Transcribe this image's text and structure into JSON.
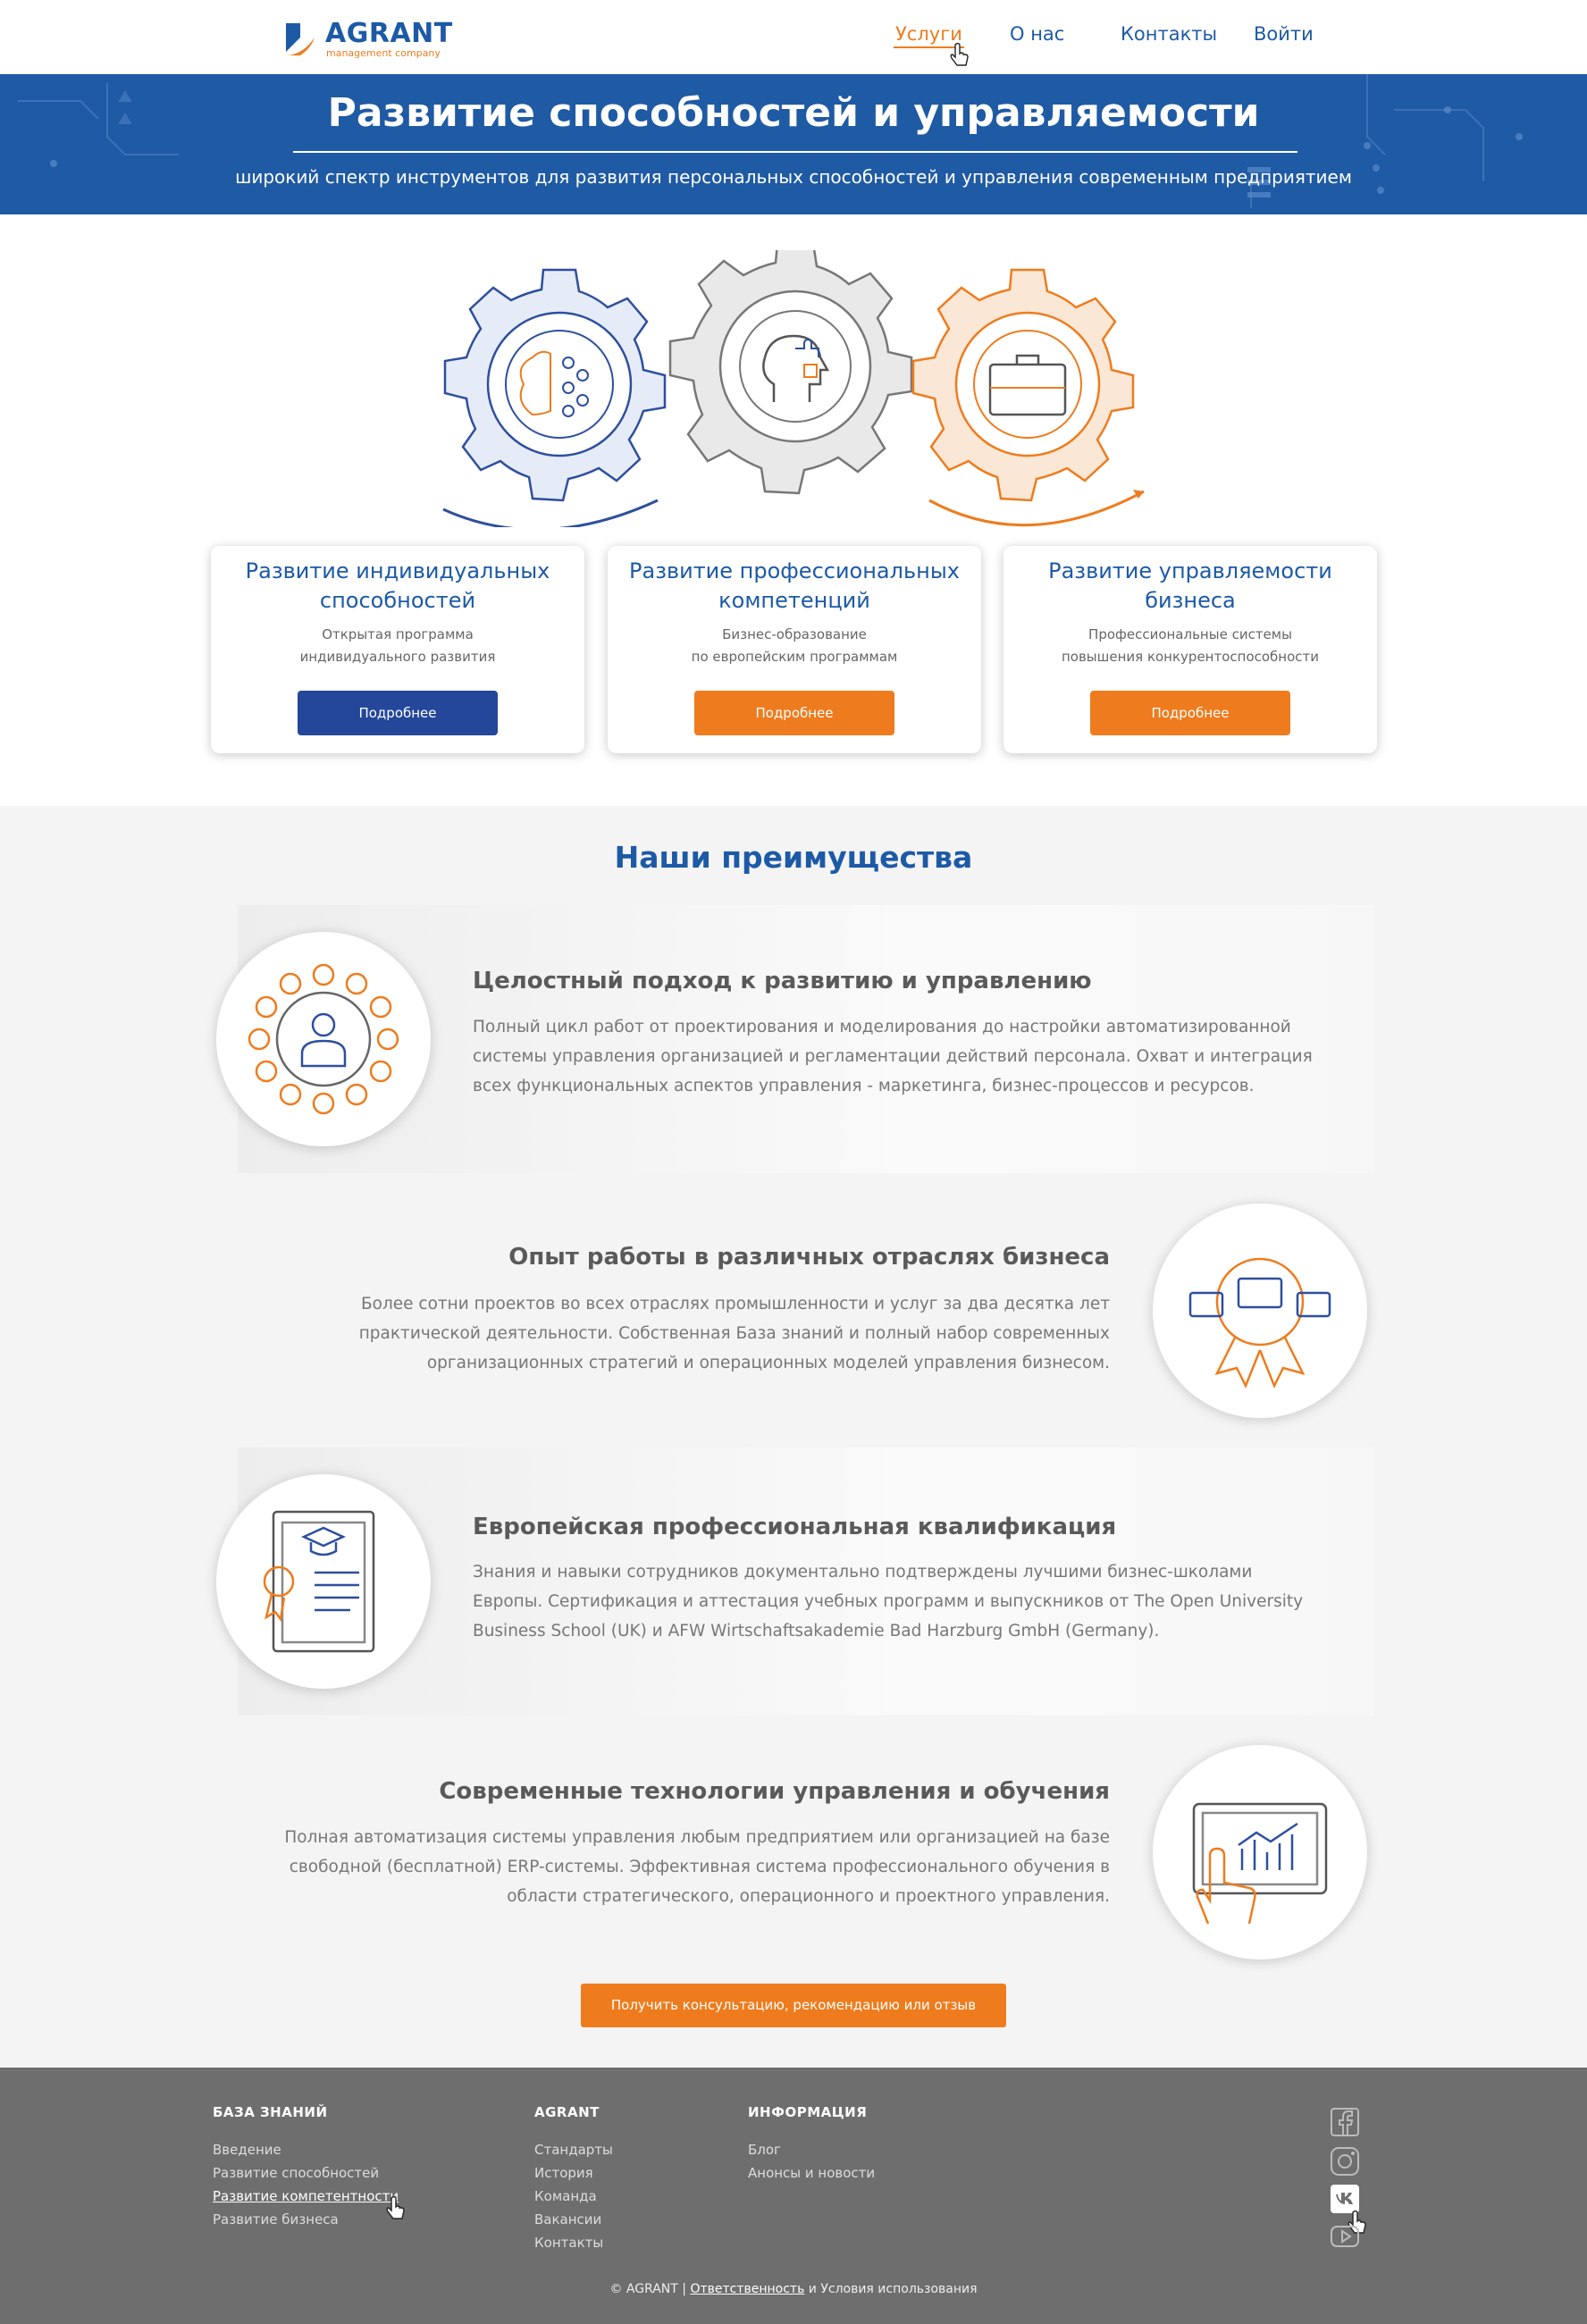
{
  "header": {
    "logo_name": "AGRANT",
    "logo_sub": "management company",
    "nav": [
      {
        "label": "Услуги",
        "active": true
      },
      {
        "label": "О нас"
      },
      {
        "label": "Контакты"
      },
      {
        "label": "Войти"
      }
    ]
  },
  "banner": {
    "title": "Развитие способностей и управляемости",
    "subtitle": "широкий спектр инструментов для развития персональных способностей и управления современным предприятием"
  },
  "services": [
    {
      "title": "Развитие индивидуальных способностей",
      "desc1": "Открытая программа",
      "desc2": "индивидуального развития",
      "button": "Подробнее",
      "button_color": "#24479a"
    },
    {
      "title": "Развитие профессиональных компетенций",
      "desc1": "Бизнес-образование",
      "desc2": "по европейским программам",
      "button": "Подробнее",
      "button_color": "#ee7c1e"
    },
    {
      "title": "Развитие управляемости бизнеса",
      "desc1": "Профессиональные системы",
      "desc2": "повышения конкурентоспособности",
      "button": "Подробнее",
      "button_color": "#ee7c1e"
    }
  ],
  "advantages": {
    "title": "Наши преимущества",
    "items": [
      {
        "heading": "Целостный подход к развитию и управлению",
        "text": "Полный цикл работ от проектирования и моделирования до настройки автоматизированной системы управления организацией и регламентации действий персонала. Охват и интеграция всех функциональных аспектов управления - маркетинга, бизнес-процессов и ресурсов.",
        "icon": "people-network-icon"
      },
      {
        "heading": "Опыт работы в различных отраслях бизнеса",
        "text": "Более сотни проектов во всех отраслях промышленности и услуг за два десятка лет практической деятельности. Собственная База знаний и полный набор современных организационных стратегий и операционных моделей управления бизнесом.",
        "icon": "briefcase-award-icon"
      },
      {
        "heading": "Европейская профессиональная квалификация",
        "text": "Знания и навыки сотрудников документально подтверждены лучшими бизнес-школами Европы. Сертификация и аттестация учебных программ и выпускников от The Open University Business School (UK) и AFW Wirtschaftsakademie Bad Harzburg GmbH (Germany).",
        "icon": "certificate-icon"
      },
      {
        "heading": "Современные технологии управления и обучения",
        "text": "Полная автоматизация системы управления любым предприятием или организацией на базе свободной (бесплатной) ERP-системы. Эффективная система профессионального обучения в области стратегического, операционного и проектного управления.",
        "icon": "touch-chart-icon"
      }
    ],
    "cta": "Получить консультацию, рекомендацию или отзыв"
  },
  "footer": {
    "col1": {
      "heading": "БАЗА ЗНАНИЙ",
      "links": [
        "Введение",
        "Развитие способностей",
        "Развитие компетентности",
        "Развитие бизнеса"
      ]
    },
    "col2": {
      "heading": "AGRANT",
      "links": [
        "Стандарты",
        "История",
        "Команда",
        "Вакансии",
        "Контакты"
      ]
    },
    "col3": {
      "heading": "ИНФОРМАЦИЯ",
      "links": [
        "Блог",
        "Анонсы и новости"
      ]
    },
    "social": [
      "facebook-icon",
      "instagram-icon",
      "vk-icon",
      "youtube-icon"
    ],
    "copyright_pre": "© AGRANT | ",
    "copyright_link1": "Ответственность",
    "copyright_mid": " и ",
    "copyright_link2": "Условия использования"
  }
}
